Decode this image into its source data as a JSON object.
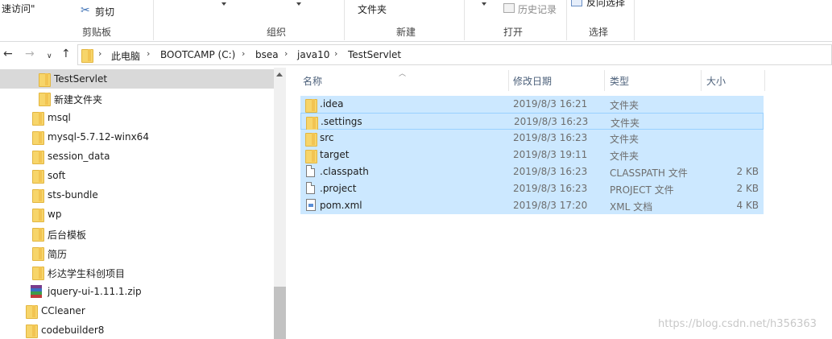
{
  "ribbon": {
    "clip_text": "速访问\"",
    "cut_label": "剪切",
    "clipboard_group": "剪贴板",
    "organize_group": "组织",
    "new_folder_label": "文件夹",
    "new_group": "新建",
    "history_label": "历史记录",
    "open_group": "打开",
    "reverse_select_label": "反向选择",
    "select_group": "选择"
  },
  "address": {
    "crumbs": [
      "此电脑",
      "BOOTCAMP (C:)",
      "bsea",
      "java10",
      "TestServlet"
    ]
  },
  "tree": [
    {
      "label": "TestServlet",
      "selected": true
    },
    {
      "label": "新建文件夹"
    },
    {
      "label": "msql"
    },
    {
      "label": "mysql-5.7.12-winx64"
    },
    {
      "label": "session_data"
    },
    {
      "label": "soft"
    },
    {
      "label": "sts-bundle"
    },
    {
      "label": "wp"
    },
    {
      "label": "后台模板"
    },
    {
      "label": "简历"
    },
    {
      "label": "杉达学生科创项目"
    },
    {
      "label": "jquery-ui-1.11.1.zip"
    },
    {
      "label": "CCleaner"
    },
    {
      "label": "codebuilder8"
    }
  ],
  "columns": {
    "name": "名称",
    "date": "修改日期",
    "type": "类型",
    "size": "大小"
  },
  "files": [
    {
      "name": ".idea",
      "date": "2019/8/3 16:21",
      "type": "文件夹",
      "size": "",
      "icon": "folder"
    },
    {
      "name": ".settings",
      "date": "2019/8/3 16:23",
      "type": "文件夹",
      "size": "",
      "icon": "folder"
    },
    {
      "name": "src",
      "date": "2019/8/3 16:23",
      "type": "文件夹",
      "size": "",
      "icon": "folder"
    },
    {
      "name": "target",
      "date": "2019/8/3 19:11",
      "type": "文件夹",
      "size": "",
      "icon": "folder"
    },
    {
      "name": ".classpath",
      "date": "2019/8/3 16:23",
      "type": "CLASSPATH 文件",
      "size": "2 KB",
      "icon": "document"
    },
    {
      "name": ".project",
      "date": "2019/8/3 16:23",
      "type": "PROJECT 文件",
      "size": "2 KB",
      "icon": "document"
    },
    {
      "name": "pom.xml",
      "date": "2019/8/3 17:20",
      "type": "XML 文档",
      "size": "4 KB",
      "icon": "xml-document"
    }
  ],
  "watermark": "https://blog.csdn.net/h356363",
  "colors": {
    "selection": "#cce8ff",
    "selection_border": "#99d1ff",
    "tree_selected": "#d9d9d9",
    "folder": "#f7d56a"
  }
}
